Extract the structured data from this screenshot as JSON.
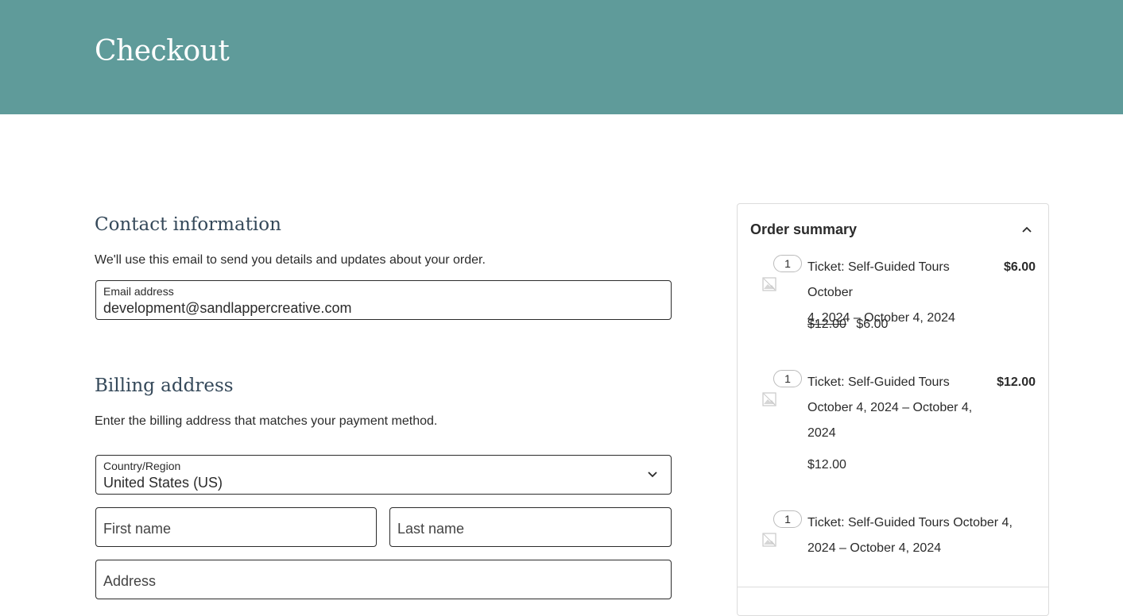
{
  "header": {
    "title": "Checkout"
  },
  "contact": {
    "title": "Contact information",
    "description": "We'll use this email to send you details and updates about your order.",
    "email_label": "Email address",
    "email_value": "development@sandlappercreative.com"
  },
  "billing": {
    "title": "Billing address",
    "description": "Enter the billing address that matches your payment method.",
    "country_label": "Country/Region",
    "country_value": "United States (US)",
    "first_name_placeholder": "First name",
    "last_name_placeholder": "Last name",
    "address_placeholder": "Address"
  },
  "summary": {
    "title": "Order summary",
    "items": [
      {
        "qty": "1",
        "name_line1": "Ticket: Self-Guided Tours October",
        "name_line2": "4, 2024 – October 4, 2024",
        "name_line3": "",
        "price": "$6.00",
        "original_price": "$12.00",
        "sale_price": "$6.00"
      },
      {
        "qty": "1",
        "name_line1": "Ticket: Self-Guided Tours",
        "name_line2": "October 4, 2024 – October 4,",
        "name_line3": "2024",
        "price": "$12.00",
        "sale_price": "$12.00"
      },
      {
        "qty": "1",
        "name_line1": "Ticket: Self-Guided Tours October 4,",
        "name_line2": "2024 – October 4, 2024",
        "name_line3": ""
      }
    ]
  },
  "icons": {
    "country_dropdown": "chevron-down-icon",
    "summary_toggle": "chevron-up-icon",
    "item_thumbnail": "image-placeholder-icon"
  },
  "colors": {
    "header_bg": "#5f9b9a",
    "heading": "#35495a"
  }
}
